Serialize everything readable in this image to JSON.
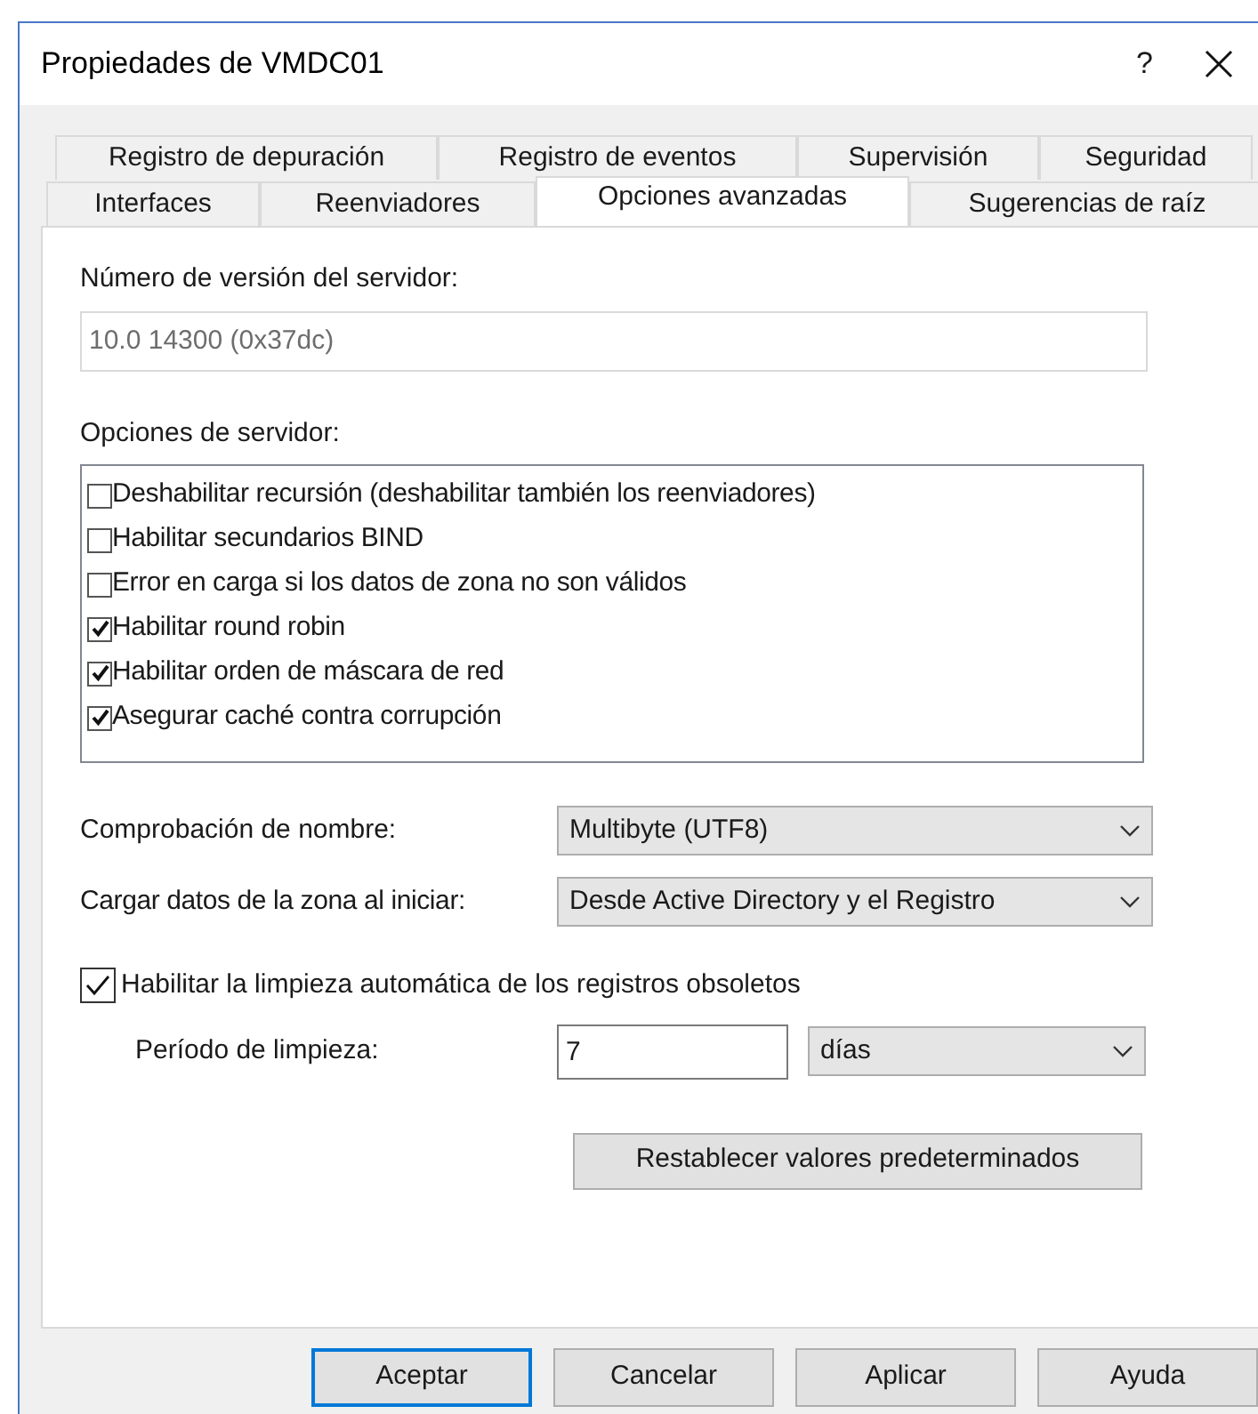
{
  "window": {
    "title": "Propiedades de VMDC01",
    "help": "?"
  },
  "tab_rows": [
    [
      {
        "label": "Registro de depuración",
        "selected": false
      },
      {
        "label": "Registro de eventos",
        "selected": false
      },
      {
        "label": "Supervisión",
        "selected": false
      },
      {
        "label": "Seguridad",
        "selected": false
      }
    ],
    [
      {
        "label": "Interfaces",
        "selected": false
      },
      {
        "label": "Reenviadores",
        "selected": false
      },
      {
        "label": "Opciones avanzadas",
        "selected": true
      },
      {
        "label": "Sugerencias de raíz",
        "selected": false
      }
    ]
  ],
  "version": {
    "label": "Número de versión del servidor:",
    "value": "10.0 14300 (0x37dc)"
  },
  "server_options": {
    "label": "Opciones de servidor:",
    "items": [
      {
        "label": "Deshabilitar recursión (deshabilitar también los reenviadores)",
        "checked": false
      },
      {
        "label": "Habilitar secundarios BIND",
        "checked": false
      },
      {
        "label": "Error en carga si los datos de zona no son válidos",
        "checked": false
      },
      {
        "label": "Habilitar round robin",
        "checked": true
      },
      {
        "label": "Habilitar orden de máscara de red",
        "checked": true
      },
      {
        "label": "Asegurar caché contra corrupción",
        "checked": true
      }
    ]
  },
  "name_check": {
    "label": "Comprobación de nombre:",
    "value": "Multibyte (UTF8)"
  },
  "load_zone": {
    "label": "Cargar datos de la zona al iniciar:",
    "value": "Desde Active Directory y el Registro"
  },
  "scavenging": {
    "label": "Habilitar la limpieza automática de los registros obsoletos",
    "checked": true
  },
  "period": {
    "label": "Período de limpieza:",
    "value": "7",
    "unit": "días"
  },
  "reset_button": "Restablecer valores predeterminados",
  "buttons": [
    {
      "label": "Aceptar",
      "default": true
    },
    {
      "label": "Cancelar",
      "default": false
    },
    {
      "label": "Aplicar",
      "default": false
    },
    {
      "label": "Ayuda",
      "default": false
    }
  ]
}
